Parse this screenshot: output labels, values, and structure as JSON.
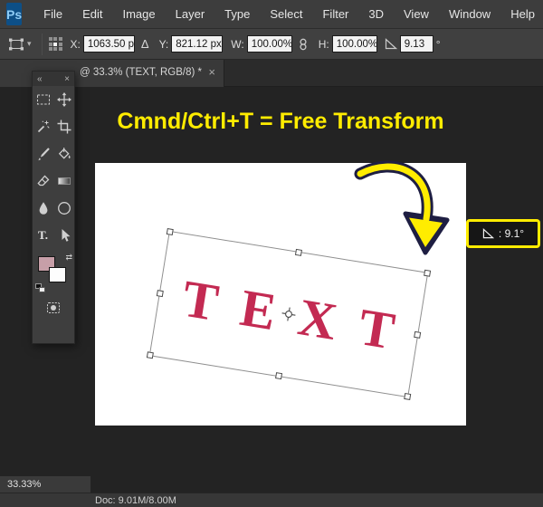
{
  "colors": {
    "yellow": "#ffec00",
    "crimson": "#c32a52",
    "ps_logo_bg": "#0d4f87",
    "ps_logo_text": "#8fccf5",
    "swatch_pink": "#c79fa8"
  },
  "menu": {
    "logo": "Ps",
    "items": [
      "File",
      "Edit",
      "Image",
      "Layer",
      "Type",
      "Select",
      "Filter",
      "3D",
      "View",
      "Window",
      "Help"
    ]
  },
  "options": {
    "caret": "▾",
    "x_label": "X:",
    "x_value": "1063.50 p",
    "delta": "Δ",
    "y_label": "Y:",
    "y_value": "821.12 px",
    "w_label": "W:",
    "w_value": "100.00%",
    "h_label": "H:",
    "h_value": "100.00%",
    "angle_value": "9.13",
    "degree": "°"
  },
  "tab": {
    "title": "@ 33.3% (TEXT, RGB/8) *",
    "close": "×"
  },
  "tool_panel": {
    "collapse": "«",
    "close": "×",
    "swap_glyph": "⇄",
    "type_glyph": "T.",
    "tools": [
      "rectangular-marquee",
      "move",
      "magic-wand",
      "crop",
      "brush",
      "paint-bucket",
      "eraser",
      "gradient",
      "blur",
      "ellipse-shape",
      "type",
      "path-select",
      "quick-mask"
    ]
  },
  "canvas": {
    "headline": "Cmnd/Ctrl+T = Free Transform",
    "text": "TEXT",
    "rotation_deg": 9.13,
    "tooltip_text": ": 9.1°"
  },
  "status": {
    "zoom": "33.33%",
    "doc": "Doc: 9.01M/8.00M"
  }
}
